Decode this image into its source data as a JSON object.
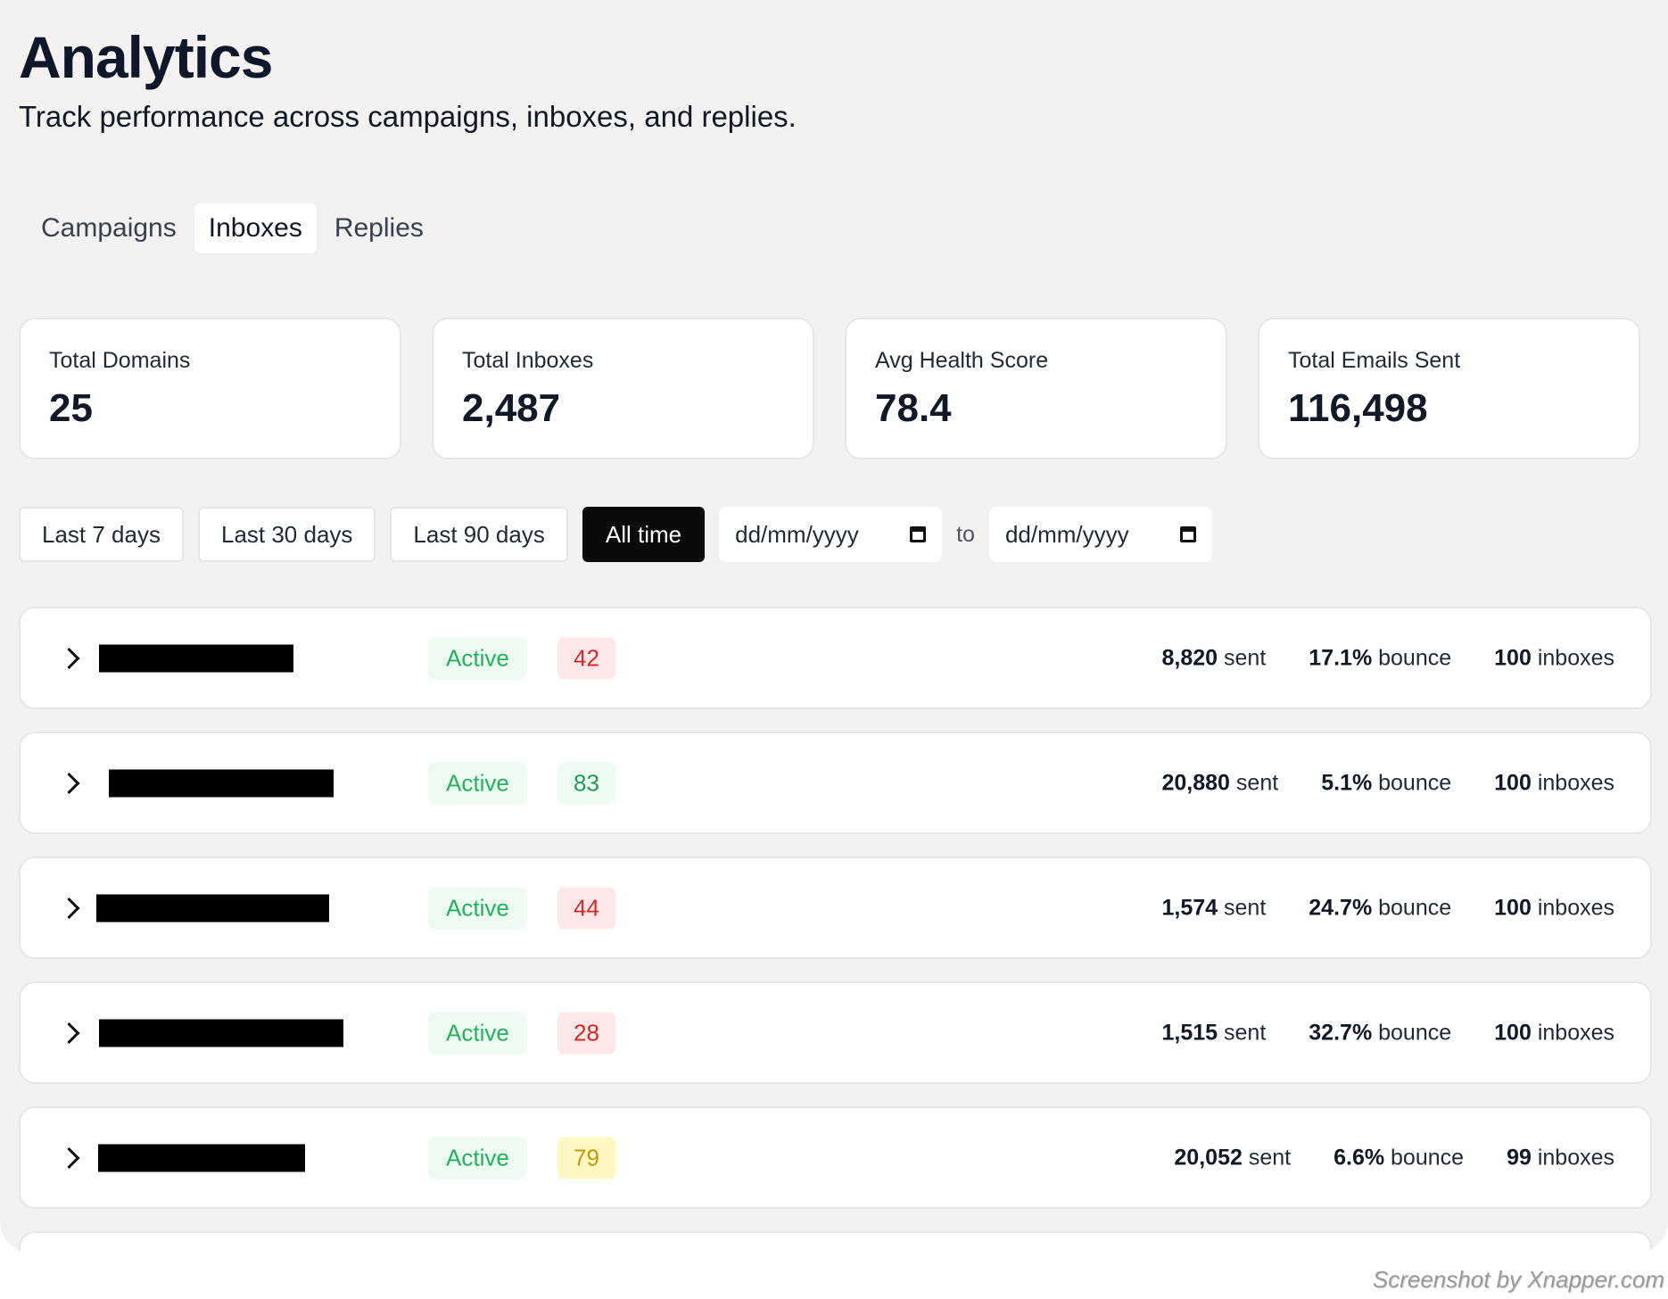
{
  "header": {
    "title": "Analytics",
    "subtitle": "Track performance across campaigns, inboxes, and replies."
  },
  "tabs": [
    {
      "label": "Campaigns",
      "active": false
    },
    {
      "label": "Inboxes",
      "active": true
    },
    {
      "label": "Replies",
      "active": false
    }
  ],
  "stats": [
    {
      "label": "Total Domains",
      "value": "25"
    },
    {
      "label": "Total Inboxes",
      "value": "2,487"
    },
    {
      "label": "Avg Health Score",
      "value": "78.4"
    },
    {
      "label": "Total Emails Sent",
      "value": "116,498"
    }
  ],
  "filters": {
    "ranges": [
      "Last 7 days",
      "Last 30 days",
      "Last 90 days",
      "All time"
    ],
    "active_range": "All time",
    "date_from_placeholder": "dd/mm/yyyy",
    "to_label": "to",
    "date_to_placeholder": "dd/mm/yyyy"
  },
  "colors": {
    "status_text": "#22b35b",
    "score_red": "#dc2626",
    "score_green": "#1f9d55",
    "score_yellow": "#c49a0b"
  },
  "rows": [
    {
      "status": "Active",
      "score": "42",
      "score_level": "red",
      "sent": "8,820",
      "sent_unit": "sent",
      "bounce": "17.1%",
      "bounce_unit": "bounce",
      "inboxes": "100",
      "inboxes_unit": "inboxes"
    },
    {
      "status": "Active",
      "score": "83",
      "score_level": "green",
      "sent": "20,880",
      "sent_unit": "sent",
      "bounce": "5.1%",
      "bounce_unit": "bounce",
      "inboxes": "100",
      "inboxes_unit": "inboxes"
    },
    {
      "status": "Active",
      "score": "44",
      "score_level": "red",
      "sent": "1,574",
      "sent_unit": "sent",
      "bounce": "24.7%",
      "bounce_unit": "bounce",
      "inboxes": "100",
      "inboxes_unit": "inboxes"
    },
    {
      "status": "Active",
      "score": "28",
      "score_level": "red",
      "sent": "1,515",
      "sent_unit": "sent",
      "bounce": "32.7%",
      "bounce_unit": "bounce",
      "inboxes": "100",
      "inboxes_unit": "inboxes"
    },
    {
      "status": "Active",
      "score": "79",
      "score_level": "yellow",
      "sent": "20,052",
      "sent_unit": "sent",
      "bounce": "6.6%",
      "bounce_unit": "bounce",
      "inboxes": "99",
      "inboxes_unit": "inboxes"
    }
  ],
  "watermark": "Screenshot by Xnapper.com"
}
